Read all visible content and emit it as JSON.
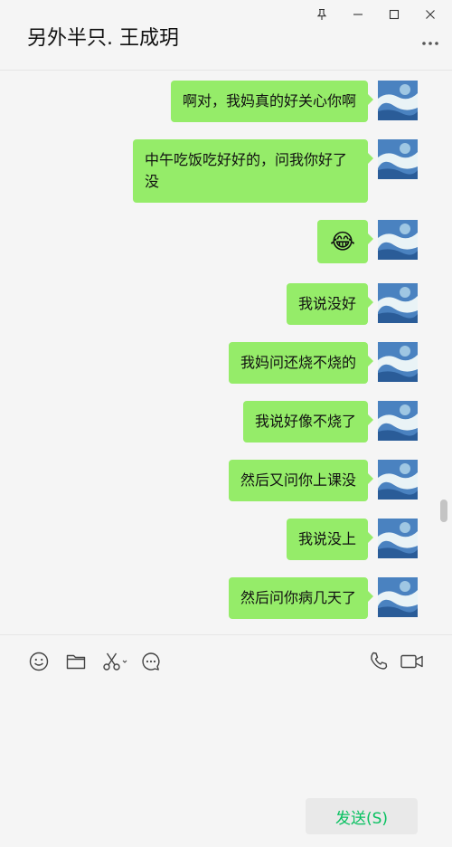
{
  "header": {
    "title": "另外半只. 王成玥"
  },
  "messages": [
    {
      "text": "啊对，我妈真的好关心你啊"
    },
    {
      "text": "中午吃饭吃好好的，问我你好了没"
    },
    {
      "text": "😂"
    },
    {
      "text": "我说没好"
    },
    {
      "text": "我妈问还烧不烧的"
    },
    {
      "text": "我说好像不烧了"
    },
    {
      "text": "然后又问你上课没"
    },
    {
      "text": "我说没上"
    },
    {
      "text": "然后问你病几天了"
    }
  ],
  "toolbar": {
    "icons": [
      "emoji-icon",
      "folder-icon",
      "scissors-icon",
      "chat-bubble-icon",
      "phone-icon",
      "video-icon"
    ]
  },
  "input": {
    "value": ""
  },
  "send_button": {
    "label": "发送(S)"
  },
  "colors": {
    "bubble": "#95ec69",
    "send_text": "#07c160",
    "background": "#f5f5f5"
  }
}
